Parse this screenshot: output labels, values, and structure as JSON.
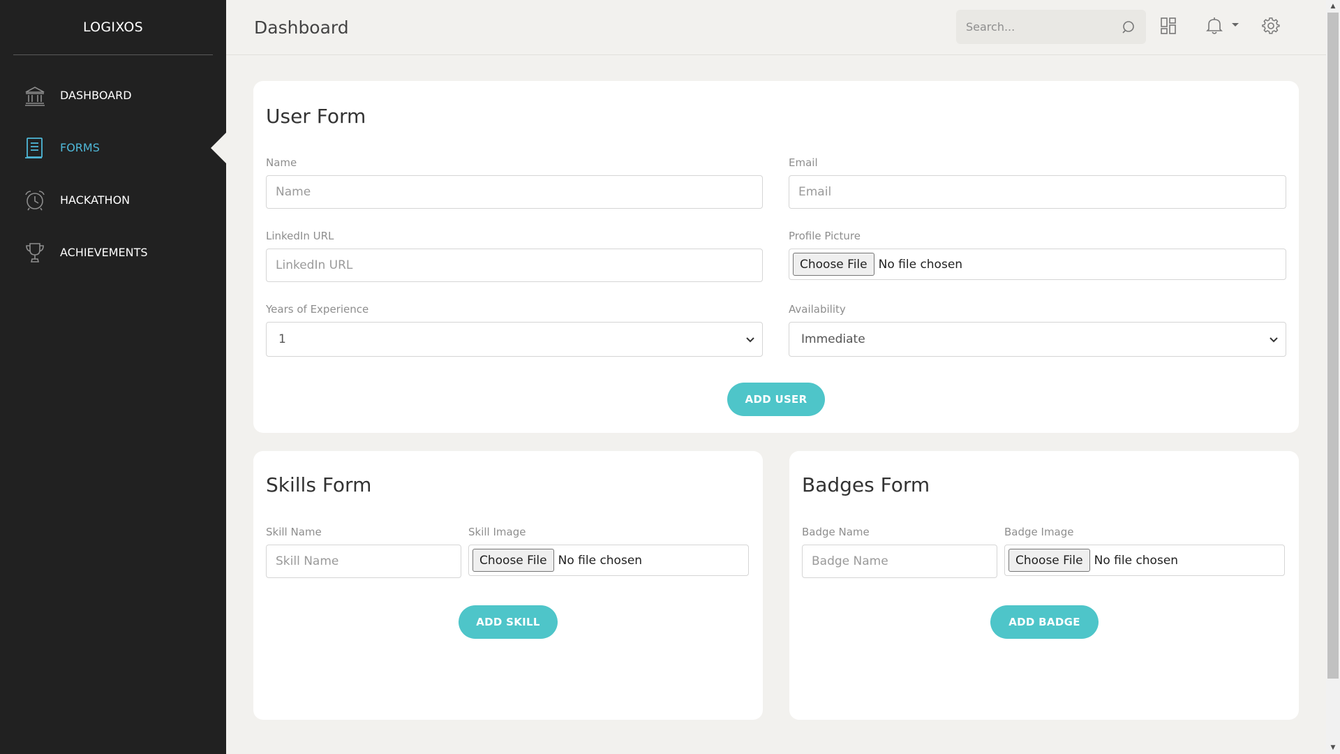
{
  "sidebar": {
    "brand": "LOGIXOS",
    "items": [
      {
        "label": "DASHBOARD",
        "icon": "bank-icon",
        "active": false
      },
      {
        "label": "FORMS",
        "icon": "document-icon",
        "active": true
      },
      {
        "label": "HACKATHON",
        "icon": "alarm-clock-icon",
        "active": false
      },
      {
        "label": "ACHIEVEMENTS",
        "icon": "trophy-icon",
        "active": false
      }
    ]
  },
  "header": {
    "title": "Dashboard",
    "search_placeholder": "Search..."
  },
  "user_form": {
    "title": "User Form",
    "name_label": "Name",
    "name_placeholder": "Name",
    "email_label": "Email",
    "email_placeholder": "Email",
    "linkedin_label": "LinkedIn URL",
    "linkedin_placeholder": "LinkedIn URL",
    "picture_label": "Profile Picture",
    "picture_button": "Choose File",
    "picture_status": "No file chosen",
    "experience_label": "Years of Experience",
    "experience_value": "1",
    "availability_label": "Availability",
    "availability_value": "Immediate",
    "submit": "ADD USER"
  },
  "skills_form": {
    "title": "Skills Form",
    "name_label": "Skill Name",
    "name_placeholder": "Skill Name",
    "image_label": "Skill Image",
    "image_button": "Choose File",
    "image_status": "No file chosen",
    "submit": "ADD SKILL"
  },
  "badges_form": {
    "title": "Badges Form",
    "name_label": "Badge Name",
    "name_placeholder": "Badge Name",
    "image_label": "Badge Image",
    "image_button": "Choose File",
    "image_status": "No file chosen",
    "submit": "ADD BADGE"
  },
  "colors": {
    "sidebar_bg": "#212121",
    "accent": "#4ec5c9",
    "active_nav": "#4fb8d8",
    "page_bg": "#f2f1ee"
  }
}
